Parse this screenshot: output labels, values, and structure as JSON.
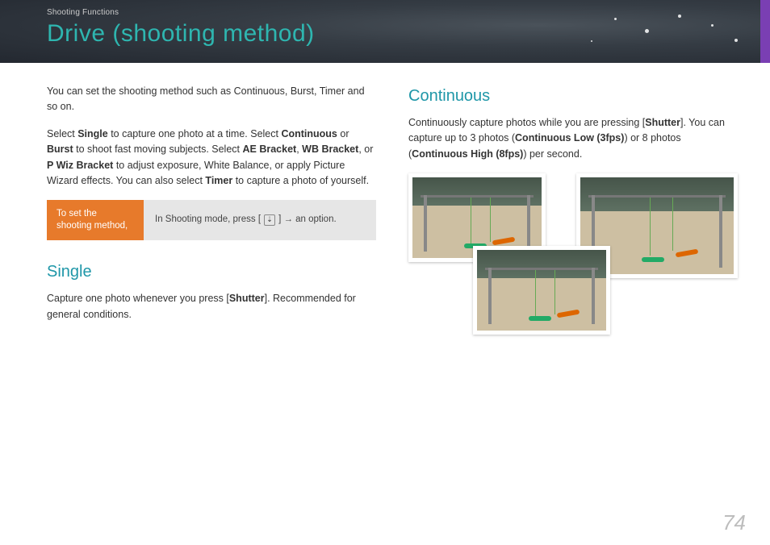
{
  "header": {
    "breadcrumb": "Shooting Functions",
    "title": "Drive (shooting method)"
  },
  "left": {
    "intro": "You can set the shooting method such as Continuous, Burst, Timer and so on.",
    "para2_a": "Select ",
    "para2_b": "Single",
    "para2_c": " to capture one photo at a time. Select ",
    "para2_d": "Continuous",
    "para2_e": " or ",
    "para2_f": "Burst",
    "para2_g": " to shoot fast moving subjects. Select ",
    "para2_h": "AE Bracket",
    "para2_i": ", ",
    "para2_j": "WB Bracket",
    "para2_k": ", or ",
    "para2_l": "P Wiz Bracket",
    "para2_m": " to adjust exposure, White Balance, or apply Picture Wizard effects. You can also select ",
    "para2_n": "Timer",
    "para2_o": " to capture a photo of yourself.",
    "instr_label": "To set the shooting method,",
    "instr_a": "In Shooting mode, press [",
    "instr_icon": "⇣",
    "instr_b": "] → an option.",
    "single_h": "Single",
    "single_p_a": "Capture one photo whenever you press [",
    "single_p_b": "Shutter",
    "single_p_c": "]. Recommended for general conditions."
  },
  "right": {
    "cont_h": "Continuous",
    "cont_a": "Continuously capture photos while you are pressing [",
    "cont_b": "Shutter",
    "cont_c": "]. You can capture up to 3 photos (",
    "cont_d": "Continuous Low (3fps)",
    "cont_e": ") or 8 photos (",
    "cont_f": "Continuous High (8fps)",
    "cont_g": ") per second."
  },
  "page_number": "74"
}
